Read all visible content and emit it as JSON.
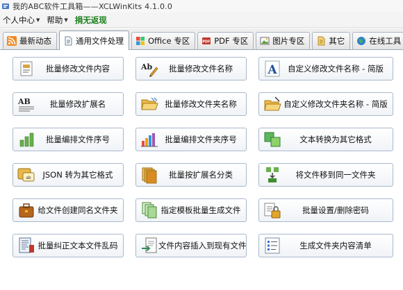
{
  "window": {
    "title": "我的ABC软件工具箱——XCLWinKits  4.1.0.0"
  },
  "menu": {
    "personal_center": "个人中心",
    "help": "帮助",
    "donate": "捐无返现"
  },
  "tabs": [
    {
      "label": "最新动态",
      "icon": "rss-icon"
    },
    {
      "label": "通用文件处理",
      "icon": "document-icon",
      "active": true
    },
    {
      "label": "Office 专区",
      "icon": "office-icon"
    },
    {
      "label": "PDF 专区",
      "icon": "pdf-icon"
    },
    {
      "label": "图片专区",
      "icon": "picture-icon"
    },
    {
      "label": "其它",
      "icon": "other-icon"
    },
    {
      "label": "在线工具",
      "icon": "globe-icon"
    }
  ],
  "buttons": [
    {
      "label": "批量修改文件内容",
      "icon": "document-edit-icon"
    },
    {
      "label": "批量修改文件名称",
      "icon": "rename-pen-icon"
    },
    {
      "label": "自定义修改文件名称 - 简版",
      "icon": "letter-a-icon"
    },
    {
      "label": "批量修改扩展名",
      "icon": "extension-ab-icon"
    },
    {
      "label": "批量修改文件夹名称",
      "icon": "folder-open-icon"
    },
    {
      "label": "自定义修改文件夹名称 - 简版",
      "icon": "folder-edit-icon"
    },
    {
      "label": "批量编排文件序号",
      "icon": "bar-chart-icon"
    },
    {
      "label": "批量编排文件夹序号",
      "icon": "color-bars-icon"
    },
    {
      "label": "文本转换为其它格式",
      "icon": "convert-blocks-icon"
    },
    {
      "label": "JSON 转为其它格式",
      "icon": "json-icon"
    },
    {
      "label": "批量按扩展名分类",
      "icon": "stacked-files-icon"
    },
    {
      "label": "将文件移到同一文件夹",
      "icon": "move-files-icon"
    },
    {
      "label": "给文件创建同名文件夹",
      "icon": "briefcase-icon"
    },
    {
      "label": "指定模板批量生成文件",
      "icon": "template-pages-icon"
    },
    {
      "label": "批量设置/删除密码",
      "icon": "lock-icon"
    },
    {
      "label": "批量纠正文本文件乱码",
      "icon": "text-fix-icon"
    },
    {
      "label": "文件内容插入到现有文件",
      "icon": "insert-file-icon"
    },
    {
      "label": "生成文件夹内容清单",
      "icon": "checklist-icon"
    }
  ]
}
